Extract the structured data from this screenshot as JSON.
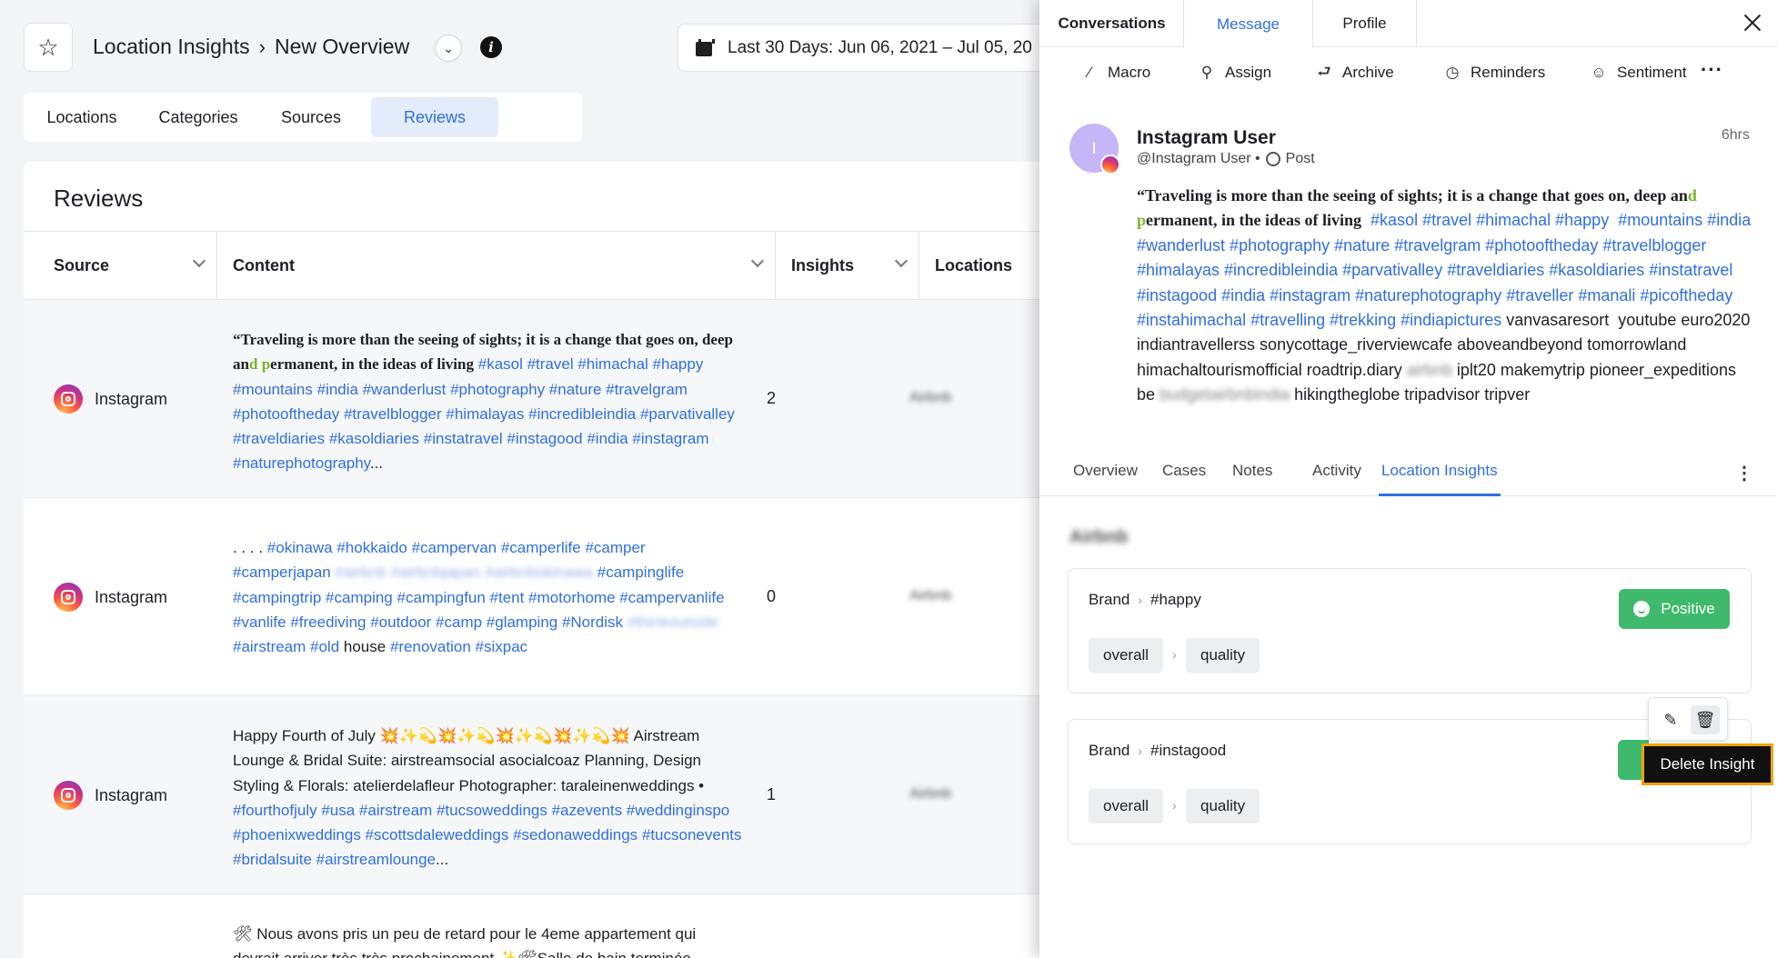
{
  "header": {
    "breadcrumb_root": "Location Insights",
    "breadcrumb_current": "New Overview",
    "date_range": "Last 30 Days: Jun 06, 2021 – Jul 05, 20"
  },
  "tabs": [
    "Locations",
    "Categories",
    "Sources",
    "Reviews"
  ],
  "active_tab": "Reviews",
  "reviews": {
    "title": "Reviews",
    "columns": [
      "Source",
      "Content",
      "Insights",
      "Locations"
    ],
    "rows": [
      {
        "source": "Instagram",
        "insights": "2",
        "location": "Airbnb"
      },
      {
        "source": "Instagram",
        "insights": "0",
        "location": "Airbnb"
      },
      {
        "source": "Instagram",
        "insights": "1",
        "location": "Airbnb"
      },
      {
        "source": "",
        "insights": "",
        "location": ""
      }
    ]
  },
  "panel": {
    "tabs": [
      "Conversations",
      "Message",
      "Profile"
    ],
    "active_tab": "Message",
    "actions": [
      "Macro",
      "Assign",
      "Archive",
      "Reminders",
      "Sentiment"
    ],
    "user": {
      "name": "Instagram User",
      "handle": "@Instagram User •",
      "type": "Post",
      "avatar_letter": "I",
      "time": "6hrs"
    },
    "subtabs": [
      "Overview",
      "Cases",
      "Notes",
      "Activity",
      "Location Insights"
    ],
    "active_subtab": "Location Insights",
    "location_name": "Airbnb",
    "insights": [
      {
        "brand": "Brand",
        "tag": "#happy",
        "path": [
          "overall",
          "quality"
        ],
        "sentiment": "Positive"
      },
      {
        "brand": "Brand",
        "tag": "#instagood",
        "path": [
          "overall",
          "quality"
        ],
        "sentiment": "Positive"
      }
    ],
    "tooltip": "Delete Insight"
  },
  "colors": {
    "accent": "#2f6fe0",
    "positive": "#3fb96b",
    "tooltip_border": "#f0a30a"
  }
}
